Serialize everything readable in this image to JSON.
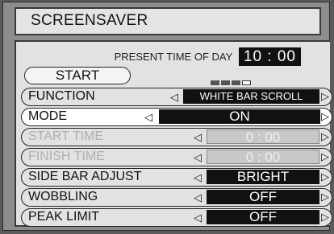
{
  "title": "SCREENSAVER",
  "present_time": {
    "label": "PRESENT TIME OF DAY",
    "value": "10 : 00"
  },
  "start_button": "START",
  "rows": [
    {
      "label": "FUNCTION",
      "value": "WHITE BAR SCROLL",
      "state": "normal"
    },
    {
      "label": "MODE",
      "value": "ON",
      "state": "active"
    },
    {
      "label": "START TIME",
      "value": "0 : 00",
      "state": "disabled"
    },
    {
      "label": "FINISH TIME",
      "value": "0 : 00",
      "state": "disabled"
    },
    {
      "label": "SIDE BAR ADJUST",
      "value": "BRIGHT",
      "state": "normal"
    },
    {
      "label": "WOBBLING",
      "value": "OFF",
      "state": "normal"
    },
    {
      "label": "PEAK LIMIT",
      "value": "OFF",
      "state": "normal"
    }
  ],
  "arrows": {
    "left": "◁",
    "right": "▷"
  },
  "colors": {
    "background": "#8d8d8d",
    "panel": "#e2e2e2",
    "value_box": "#111111",
    "disabled_text": "#b0b0b0"
  }
}
